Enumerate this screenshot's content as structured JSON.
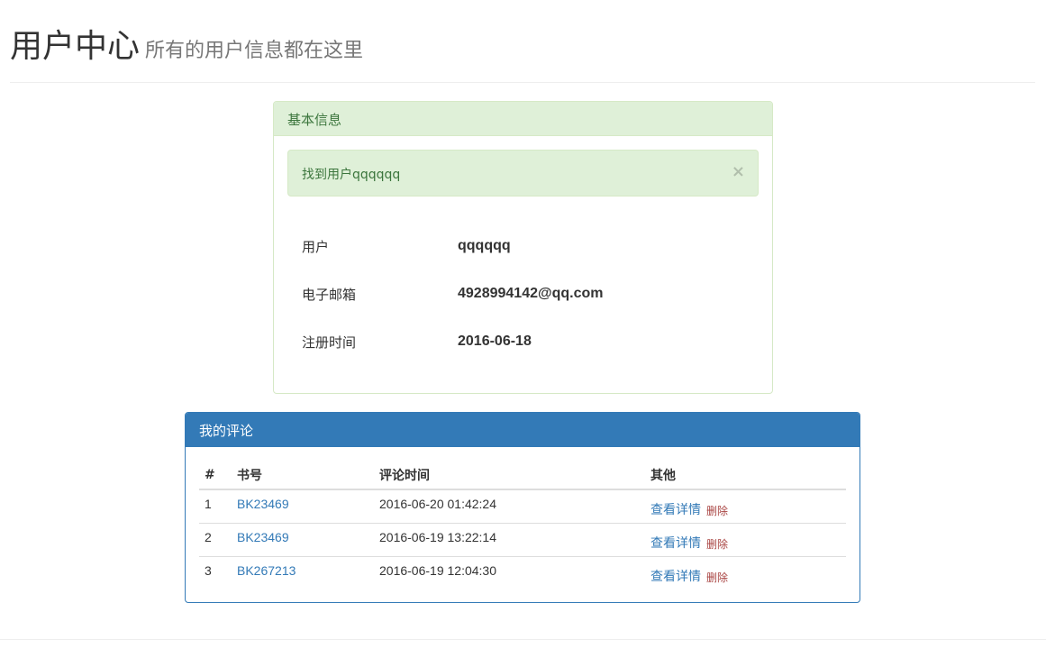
{
  "header": {
    "title": "用户中心",
    "subtitle": "所有的用户信息都在这里"
  },
  "basic_info": {
    "heading": "基本信息",
    "alert": {
      "message": "找到用户qqqqqq",
      "close_glyph": "×"
    },
    "rows": [
      {
        "label": "用户",
        "value": "qqqqqq"
      },
      {
        "label": "电子邮箱",
        "value": "4928994142@qq.com"
      },
      {
        "label": "注册时间",
        "value": "2016-06-18"
      }
    ]
  },
  "comments": {
    "heading": "我的评论",
    "columns": [
      "#",
      "书号",
      "评论时间",
      "其他"
    ],
    "rows": [
      {
        "num": "1",
        "book": "BK23469",
        "time": "2016-06-20 01:42:24",
        "detail": "查看详情",
        "delete": "删除"
      },
      {
        "num": "2",
        "book": "BK23469",
        "time": "2016-06-19 13:22:14",
        "detail": "查看详情",
        "delete": "删除"
      },
      {
        "num": "3",
        "book": "BK267213",
        "time": "2016-06-19 12:04:30",
        "detail": "查看详情",
        "delete": "删除"
      }
    ]
  },
  "colors": {
    "success_bg": "#dff0d8",
    "success_text": "#3c763d",
    "primary": "#337ab7",
    "danger": "#a94442"
  }
}
